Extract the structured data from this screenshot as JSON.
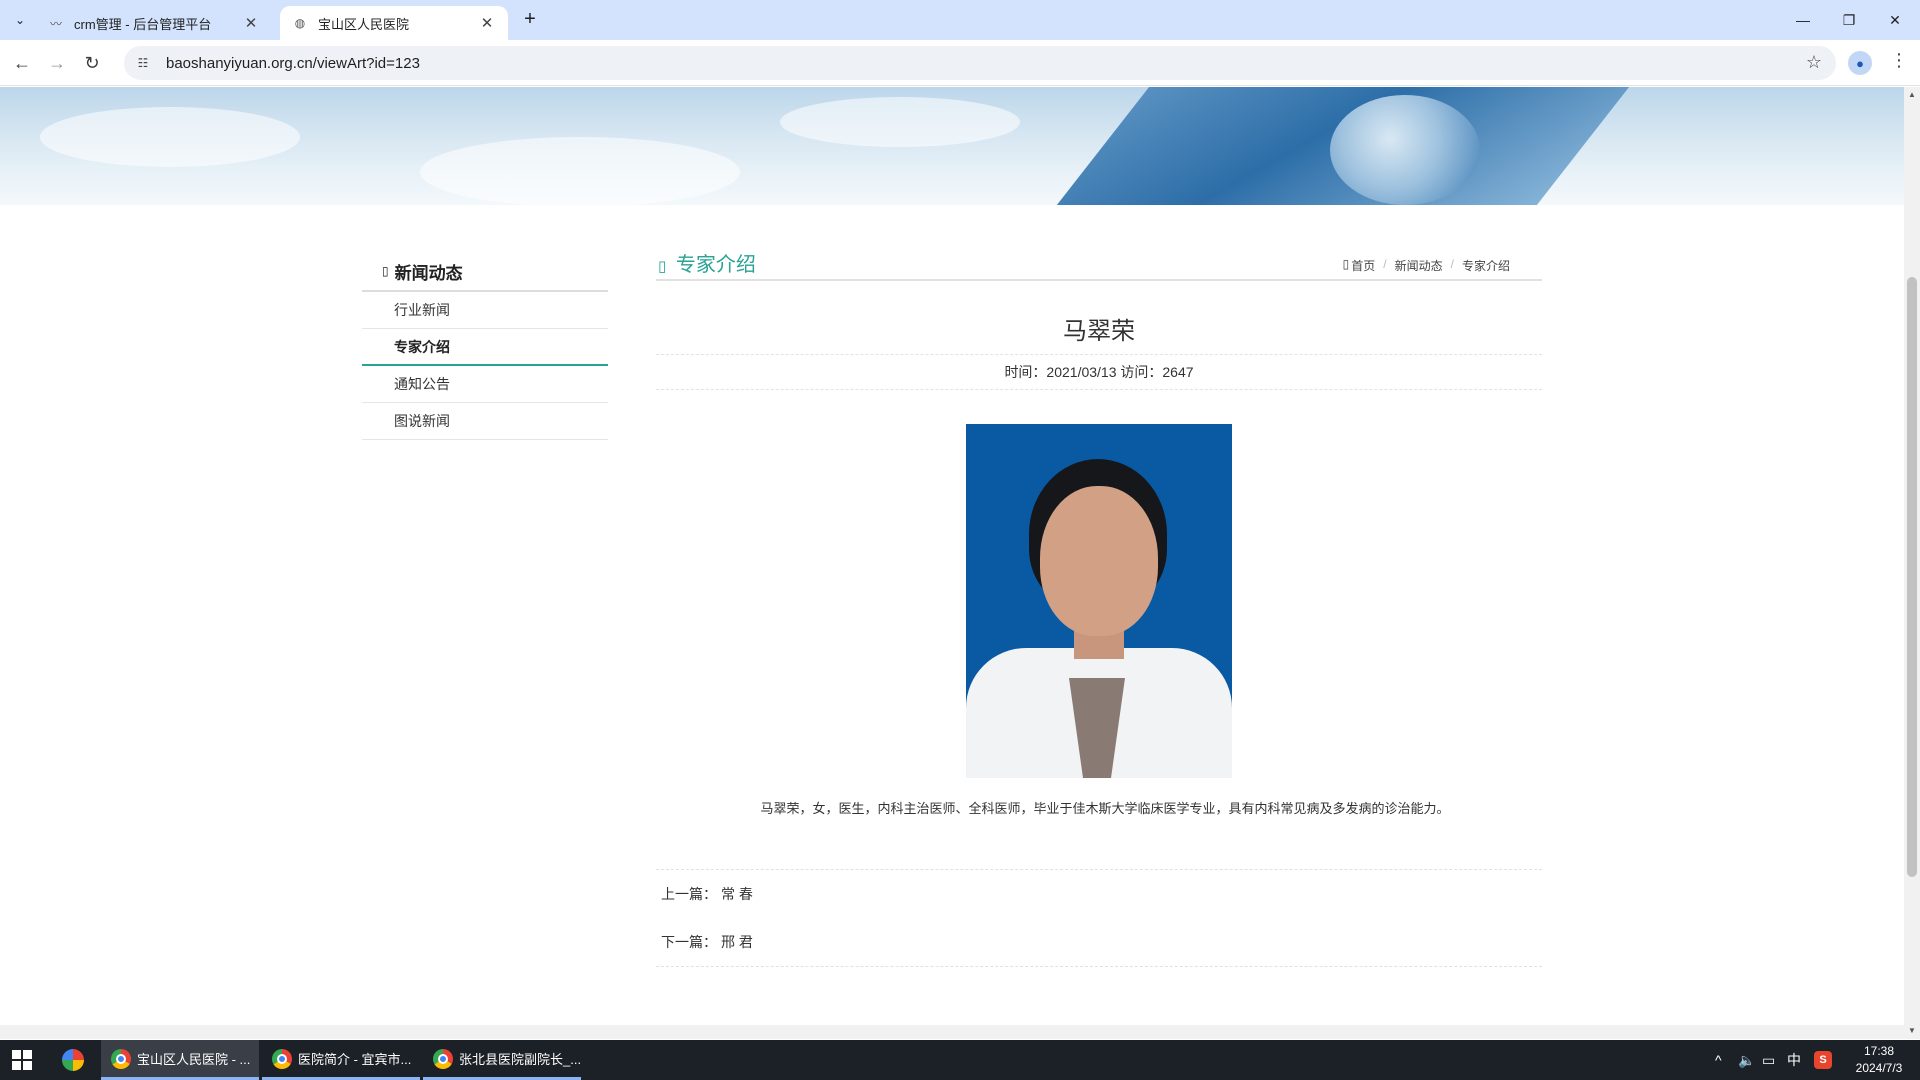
{
  "browser": {
    "tabs": [
      {
        "title": "crm管理 - 后台管理平台",
        "active": false
      },
      {
        "title": "宝山区人民医院",
        "active": true
      }
    ],
    "url": "baoshanyiyuan.org.cn/viewArt?id=123",
    "icons": {
      "tab_search": "chevron-down-icon",
      "new_tab": "plus-icon",
      "back": "arrow-left-icon",
      "forward": "arrow-right-icon",
      "reload": "reload-icon",
      "site_info": "tune-icon",
      "bookmark": "star-icon",
      "profile": "person-icon",
      "menu": "more-vert-icon"
    }
  },
  "sidebar": {
    "title": "新闻动态",
    "items": [
      {
        "label": "行业新闻",
        "active": false
      },
      {
        "label": "专家介绍",
        "active": true
      },
      {
        "label": "通知公告",
        "active": false
      },
      {
        "label": "图说新闻",
        "active": false
      }
    ]
  },
  "content": {
    "section_title": "专家介绍",
    "breadcrumb": [
      "首页",
      "新闻动态",
      "专家介绍"
    ],
    "article": {
      "title": "马翠荣",
      "meta": "时间：2021/03/13 访问：2647",
      "description": "马翠荣，女，医生，内科主治医师、全科医师，毕业于佳木斯大学临床医学专业，具有内科常见病及多发病的诊治能力。"
    },
    "prev": {
      "label": "上一篇：",
      "title": "常 春"
    },
    "next": {
      "label": "下一篇：",
      "title": "邢 君"
    }
  },
  "taskbar": {
    "items": [
      {
        "label": "宝山区人民医院 - ...",
        "active": true
      },
      {
        "label": "医院简介 - 宜宾市...",
        "active": false
      },
      {
        "label": "张北县医院副院长_...",
        "active": false
      }
    ],
    "tray": {
      "ime": "中",
      "time": "17:38",
      "date": "2024/7/3"
    }
  },
  "colors": {
    "accent": "#2aa294",
    "tabstrip": "#d3e3fd",
    "taskbar": "#1c2027",
    "photo_bg": "#0a5aa3"
  }
}
